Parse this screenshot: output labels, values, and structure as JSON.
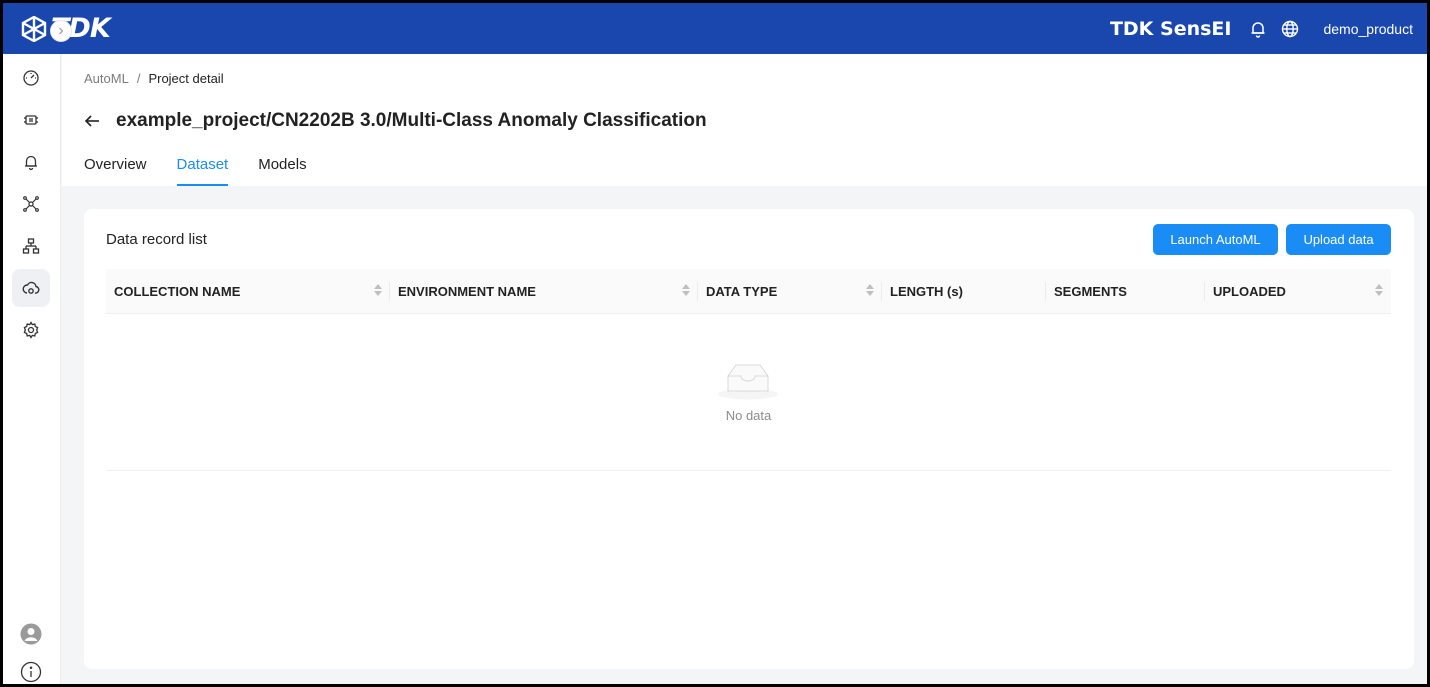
{
  "topbar": {
    "logo_text": "TDK",
    "product_name": "TDK SensEI",
    "username": "demo_product"
  },
  "sidebar": {
    "items": [
      {
        "icon": "dashboard-icon"
      },
      {
        "icon": "chip-icon"
      },
      {
        "icon": "bell-icon"
      },
      {
        "icon": "network-icon"
      },
      {
        "icon": "hierarchy-icon"
      },
      {
        "icon": "cloud-sync-icon",
        "active": true
      },
      {
        "icon": "gear-icon"
      }
    ],
    "bottom": [
      {
        "icon": "user-avatar-icon"
      },
      {
        "icon": "info-icon"
      }
    ]
  },
  "breadcrumb": {
    "parent": "AutoML",
    "separator": "/",
    "current": "Project detail"
  },
  "page": {
    "title": "example_project/CN2202B 3.0/Multi-Class Anomaly Classification"
  },
  "tabs": [
    {
      "label": "Overview"
    },
    {
      "label": "Dataset",
      "active": true
    },
    {
      "label": "Models"
    }
  ],
  "card": {
    "title": "Data record list",
    "launch_label": "Launch AutoML",
    "upload_label": "Upload data"
  },
  "table": {
    "columns": [
      {
        "label": "COLLECTION NAME",
        "sortable": true
      },
      {
        "label": "ENVIRONMENT NAME",
        "sortable": true
      },
      {
        "label": "DATA TYPE",
        "sortable": true
      },
      {
        "label": "LENGTH (s)",
        "sortable": false
      },
      {
        "label": "SEGMENTS",
        "sortable": false
      },
      {
        "label": "UPLOADED",
        "sortable": true
      }
    ],
    "empty_text": "No data"
  },
  "colors": {
    "topbar": "#1a47ad",
    "accent": "#1a8cf5"
  }
}
